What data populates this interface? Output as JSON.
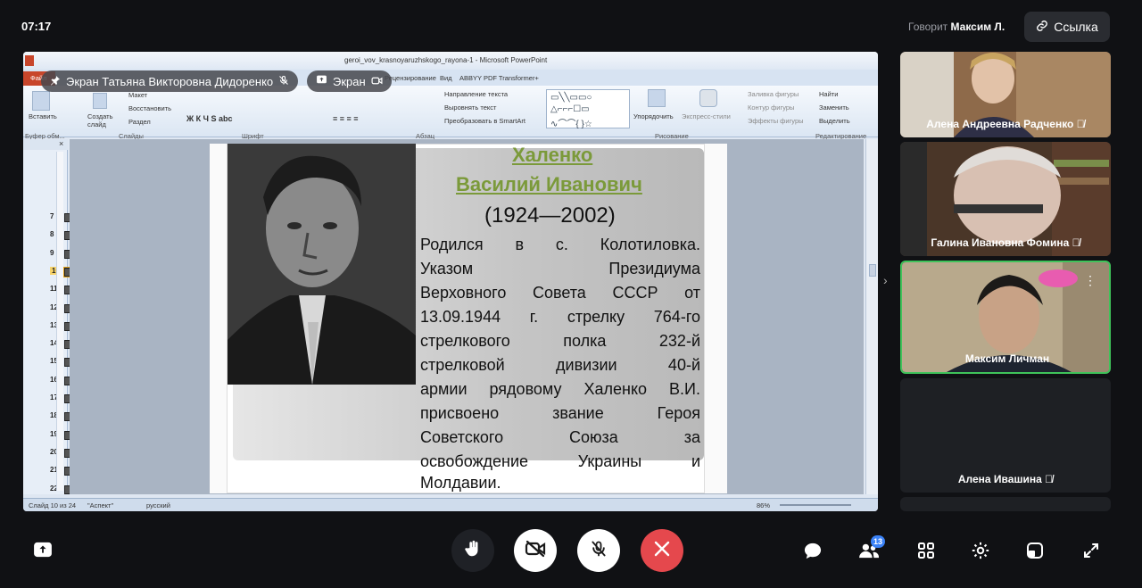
{
  "topbar": {
    "clock": "07:17",
    "speaking_label": "Говорит",
    "speaking_name": "Максим Л.",
    "link_button": "Ссылка"
  },
  "screen_share": {
    "presenter_pill": "Экран Татьяна Викторовна Дидоренко",
    "screen_pill": "Экран",
    "window_title": "geroi_vov_krasnoyaruzhskogo_rayona-1 - Microsoft PowerPoint",
    "tabs": [
      "Файл",
      "Вставка",
      "Дизайн",
      "Переходы",
      "Анимация",
      "Показ слайдов",
      "Рецензирование",
      "Вид",
      "ABBYY PDF Transformer+"
    ],
    "ribbon": {
      "paste": "Вставить",
      "new_slide": "Создать слайд",
      "layout": "Макет",
      "reset": "Восстановить",
      "section": "Раздел",
      "text_direction": "Направление текста",
      "align_text": "Выровнять текст",
      "smartart": "Преобразовать в SmartArt",
      "arrange": "Упорядочить",
      "quick_styles": "Экспресс-стили",
      "shape_fill": "Заливка фигуры",
      "shape_outline": "Контур фигуры",
      "shape_effects": "Эффекты фигуры",
      "find": "Найти",
      "replace": "Заменить",
      "select": "Выделить",
      "groups": [
        "Буфер обм...",
        "Слайды",
        "Шрифт",
        "Абзац",
        "Рисование",
        "Редактирование"
      ]
    },
    "thumbnail_numbers": [
      "7",
      "8",
      "9",
      "10",
      "11",
      "12",
      "13",
      "14",
      "15",
      "16",
      "17",
      "18",
      "19",
      "20",
      "21",
      "22",
      "23",
      "24"
    ],
    "slide": {
      "surname": "Халенко",
      "name": "Василий Иванович",
      "years": "(1924—2002)",
      "bio_lines": [
        "Родился в с. Колотиловка.",
        "Указом Президиума",
        "Верховного Совета СССР от",
        "13.09.1944 г. стрелку 764-го",
        "стрелкового полка 232-й",
        "стрелковой дивизии 40-й",
        "армии рядовому Халенко В.И.",
        "присвоено звание Героя",
        "Советского Союза за",
        "освобождение Украины и"
      ],
      "bio_last": "Молдавии."
    },
    "status_bar": {
      "slide_info": "Слайд 10 из 24",
      "theme": "\"Аспект\"",
      "language": "русский",
      "zoom": "86%"
    }
  },
  "participants": [
    {
      "name": "Алена Андреевна Радченко",
      "muted": true
    },
    {
      "name": "Галина Ивановна Фомина",
      "muted": true
    },
    {
      "name": "Максим Личман",
      "muted": false,
      "speaking": true
    },
    {
      "name": "Алена Ивашина",
      "muted": true
    }
  ],
  "controls": {
    "participants_count": "13"
  },
  "colors": {
    "background": "#101114",
    "end_call": "#e5484d",
    "speaking_border": "#3fc35a",
    "slide_title_green": "#7b9a3a"
  }
}
